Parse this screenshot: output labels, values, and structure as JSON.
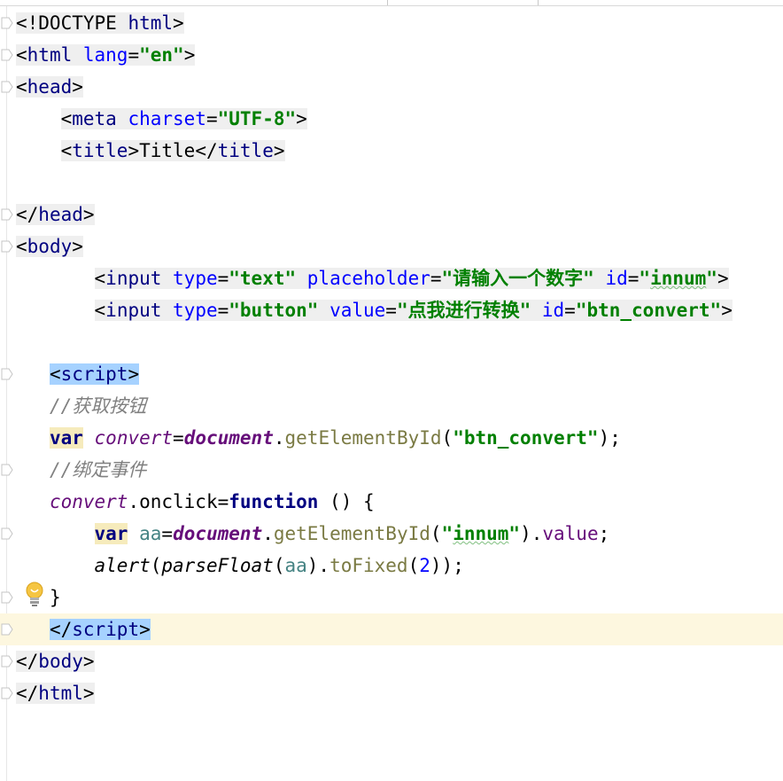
{
  "editor": {
    "lines": [
      {
        "indent": "",
        "tokens": [
          {
            "c": "t-punct",
            "t": "<!DOCTYPE "
          },
          {
            "c": "t-tag",
            "t": "html"
          },
          {
            "c": "t-punct",
            "t": ">"
          }
        ]
      },
      {
        "indent": "",
        "tokens": [
          {
            "c": "t-punct",
            "t": "<"
          },
          {
            "c": "t-tag",
            "t": "html "
          },
          {
            "c": "t-attr",
            "t": "lang"
          },
          {
            "c": "t-punct",
            "t": "="
          },
          {
            "c": "t-str",
            "t": "\"en\""
          },
          {
            "c": "t-punct",
            "t": ">"
          }
        ]
      },
      {
        "indent": "",
        "tokens": [
          {
            "c": "t-punct",
            "t": "<"
          },
          {
            "c": "t-tag",
            "t": "head"
          },
          {
            "c": "t-punct",
            "t": ">"
          }
        ]
      },
      {
        "indent": "    ",
        "tokens": [
          {
            "c": "t-punct",
            "t": "<"
          },
          {
            "c": "t-tag",
            "t": "meta "
          },
          {
            "c": "t-attr",
            "t": "charset"
          },
          {
            "c": "t-punct",
            "t": "="
          },
          {
            "c": "t-str",
            "t": "\"UTF-8\""
          },
          {
            "c": "t-punct",
            "t": ">"
          }
        ]
      },
      {
        "indent": "    ",
        "tokens": [
          {
            "c": "t-punct",
            "t": "<"
          },
          {
            "c": "t-tag",
            "t": "title"
          },
          {
            "c": "t-punct",
            "t": ">"
          },
          {
            "c": "t-text",
            "t": "Title"
          },
          {
            "c": "t-punct",
            "t": "</"
          },
          {
            "c": "t-tag",
            "t": "title"
          },
          {
            "c": "t-punct",
            "t": ">"
          }
        ]
      },
      {
        "indent": "",
        "tokens": []
      },
      {
        "indent": "",
        "tokens": [
          {
            "c": "t-punct",
            "t": "</"
          },
          {
            "c": "t-tag",
            "t": "head"
          },
          {
            "c": "t-punct",
            "t": ">"
          }
        ]
      },
      {
        "indent": "",
        "tokens": [
          {
            "c": "t-punct",
            "t": "<"
          },
          {
            "c": "t-tag",
            "t": "body"
          },
          {
            "c": "t-punct",
            "t": ">"
          }
        ]
      },
      {
        "indent": "       ",
        "tokens": [
          {
            "c": "t-punct",
            "t": "<"
          },
          {
            "c": "t-tag",
            "t": "input "
          },
          {
            "c": "t-attr",
            "t": "type"
          },
          {
            "c": "t-punct",
            "t": "="
          },
          {
            "c": "t-str",
            "t": "\"text\" "
          },
          {
            "c": "t-attr",
            "t": "placeholder"
          },
          {
            "c": "t-punct",
            "t": "="
          },
          {
            "c": "t-str",
            "t": "\"请输入一个数字\" "
          },
          {
            "c": "t-attr",
            "t": "id"
          },
          {
            "c": "t-punct",
            "t": "="
          },
          {
            "c": "t-str",
            "t": "\""
          },
          {
            "c": "t-str squig",
            "t": "innum"
          },
          {
            "c": "t-str",
            "t": "\""
          },
          {
            "c": "t-punct",
            "t": ">"
          }
        ]
      },
      {
        "indent": "       ",
        "tokens": [
          {
            "c": "t-punct",
            "t": "<"
          },
          {
            "c": "t-tag",
            "t": "input "
          },
          {
            "c": "t-attr",
            "t": "type"
          },
          {
            "c": "t-punct",
            "t": "="
          },
          {
            "c": "t-str",
            "t": "\"button\" "
          },
          {
            "c": "t-attr",
            "t": "value"
          },
          {
            "c": "t-punct",
            "t": "="
          },
          {
            "c": "t-str",
            "t": "\"点我进行转换\" "
          },
          {
            "c": "t-attr",
            "t": "id"
          },
          {
            "c": "t-punct",
            "t": "="
          },
          {
            "c": "t-str",
            "t": "\"btn_convert\""
          },
          {
            "c": "t-punct",
            "t": ">"
          }
        ]
      },
      {
        "indent": "",
        "tokens": []
      },
      {
        "indent": "   ",
        "tokens": [
          {
            "c": "t-punct hl",
            "t": "<"
          },
          {
            "c": "t-tag hl",
            "t": "script"
          },
          {
            "c": "t-punct hl",
            "t": ">"
          }
        ]
      },
      {
        "indent": "   ",
        "tokens": [
          {
            "c": "t-com",
            "t": "//获取按钮"
          }
        ]
      },
      {
        "indent": "   ",
        "tokens": [
          {
            "c": "t-kw kwbg",
            "t": "var"
          },
          {
            "c": "t-text",
            "t": " "
          },
          {
            "c": "t-var",
            "t": "convert"
          },
          {
            "c": "t-text",
            "t": "="
          },
          {
            "c": "t-glob",
            "t": "document"
          },
          {
            "c": "t-text",
            "t": "."
          },
          {
            "c": "t-meth",
            "t": "getElementById"
          },
          {
            "c": "t-text",
            "t": "("
          },
          {
            "c": "t-str",
            "t": "\"btn_convert\""
          },
          {
            "c": "t-text",
            "t": ");"
          }
        ]
      },
      {
        "indent": "   ",
        "tokens": [
          {
            "c": "t-com",
            "t": "//绑定事件"
          }
        ]
      },
      {
        "indent": "   ",
        "tokens": [
          {
            "c": "t-var",
            "t": "convert"
          },
          {
            "c": "t-text",
            "t": ".onclick="
          },
          {
            "c": "t-kw",
            "t": "function"
          },
          {
            "c": "t-text",
            "t": " () {"
          }
        ]
      },
      {
        "indent": "       ",
        "tokens": [
          {
            "c": "t-kw kwbg",
            "t": "var"
          },
          {
            "c": "t-text",
            "t": " "
          },
          {
            "c": "t-local",
            "t": "aa"
          },
          {
            "c": "t-text",
            "t": "="
          },
          {
            "c": "t-glob",
            "t": "document"
          },
          {
            "c": "t-text",
            "t": "."
          },
          {
            "c": "t-meth",
            "t": "getElementById"
          },
          {
            "c": "t-text",
            "t": "("
          },
          {
            "c": "t-str",
            "t": "\""
          },
          {
            "c": "t-str squig",
            "t": "innum"
          },
          {
            "c": "t-str",
            "t": "\""
          },
          {
            "c": "t-text",
            "t": ")."
          },
          {
            "c": "t-prop",
            "t": "value"
          },
          {
            "c": "t-text",
            "t": ";"
          }
        ]
      },
      {
        "indent": "       ",
        "tokens": [
          {
            "c": "t-fn",
            "t": "alert"
          },
          {
            "c": "t-text",
            "t": "("
          },
          {
            "c": "t-fn",
            "t": "parseFloat"
          },
          {
            "c": "t-text",
            "t": "("
          },
          {
            "c": "t-local",
            "t": "aa"
          },
          {
            "c": "t-text",
            "t": ")."
          },
          {
            "c": "t-meth",
            "t": "toFixed"
          },
          {
            "c": "t-text",
            "t": "("
          },
          {
            "c": "t-num",
            "t": "2"
          },
          {
            "c": "t-text",
            "t": "));"
          }
        ]
      },
      {
        "indent": "   ",
        "tokens": [
          {
            "c": "t-text",
            "t": "}"
          }
        ]
      },
      {
        "indent": "   ",
        "caret": true,
        "tokens": [
          {
            "c": "t-punct hl",
            "t": "</"
          },
          {
            "c": "t-tag hl",
            "t": "script"
          },
          {
            "c": "t-punct hl",
            "t": ">"
          }
        ]
      },
      {
        "indent": "",
        "tokens": [
          {
            "c": "t-punct",
            "t": "</"
          },
          {
            "c": "t-tag",
            "t": "body"
          },
          {
            "c": "t-punct",
            "t": ">"
          }
        ]
      },
      {
        "indent": "",
        "tokens": [
          {
            "c": "t-punct",
            "t": "</"
          },
          {
            "c": "t-tag",
            "t": "html"
          },
          {
            "c": "t-punct",
            "t": ">"
          }
        ]
      }
    ],
    "tag_block_lines": [
      1,
      2,
      3,
      4,
      5,
      7,
      8,
      9,
      10,
      21,
      22
    ],
    "fold_markers": [
      1,
      2,
      3,
      7,
      8,
      12,
      15,
      17,
      19,
      20,
      21,
      22
    ],
    "intention_icon": "lightbulb-icon"
  }
}
